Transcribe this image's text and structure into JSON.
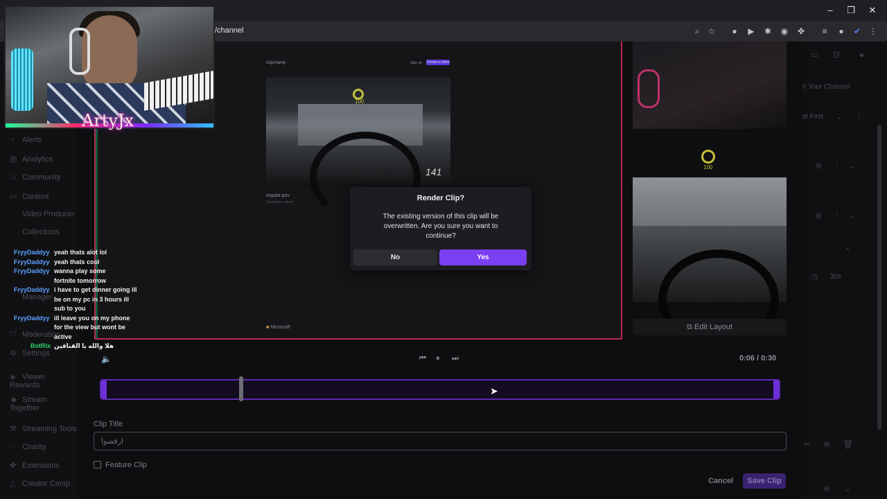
{
  "browser": {
    "url": "/channel",
    "window_controls": [
      "–",
      "❐",
      "✕"
    ]
  },
  "sidebar": {
    "items": [
      {
        "label": "Alerts",
        "icon": "bell-icon"
      },
      {
        "label": "Analytics",
        "icon": "chart-icon"
      },
      {
        "label": "Community",
        "icon": "people-icon"
      },
      {
        "label": "Content",
        "icon": "folder-icon"
      },
      {
        "label": "Video Producer",
        "icon": ""
      },
      {
        "label": "Collections",
        "icon": ""
      },
      {
        "label": "Manager",
        "icon": ""
      },
      {
        "label": "Moderation",
        "icon": "shield-icon"
      },
      {
        "label": "Settings",
        "icon": "gear-icon"
      },
      {
        "label": "Viewer Rewards",
        "icon": "gift-icon"
      },
      {
        "label": "Stream Together",
        "icon": "users-icon"
      },
      {
        "label": "Streaming Tools",
        "icon": "tools-icon"
      },
      {
        "label": "Charity",
        "icon": "heart-icon"
      },
      {
        "label": "Extensions",
        "icon": "puzzle-icon"
      },
      {
        "label": "Creator Camp",
        "icon": "tent-icon"
      }
    ]
  },
  "right_ghost": {
    "channel_label": "n Your Channel",
    "sort_label": "st First",
    "duration": "30s"
  },
  "webcam": {
    "streamer_name": "ArtyJx"
  },
  "preview": {
    "app_name": "Clipchamp",
    "signup": "Sign up",
    "create": "Create a video",
    "video_title": "impala pov",
    "video_sub": "Created by admin",
    "footer_brand": "Microsoft",
    "speed_text": "141",
    "gauge_value": "100"
  },
  "right_cam": {
    "gauge_value": "100",
    "edit_layout_label": "Edit Layout"
  },
  "chat": [
    {
      "user": "FryyDaddyy",
      "message": "yeah thats alot lol",
      "bot": false
    },
    {
      "user": "FryyDaddyy",
      "message": "yeah thats cool",
      "bot": false
    },
    {
      "user": "FryyDaddyy",
      "message": "wanna play some fortnite tomorrow",
      "bot": false
    },
    {
      "user": "FryyDaddyy",
      "message": "i have to get dinner going ill be on my pc in 3 hours ill sub to you",
      "bot": false
    },
    {
      "user": "FryyDaddyy",
      "message": "ill leave you on my phone for the view but wont be active",
      "bot": false
    },
    {
      "user": "BotRix",
      "message": "هلا والله يا القناقين",
      "bot": true
    }
  ],
  "player": {
    "timecode": "0:06 / 0:30",
    "progress_fraction": 0.2
  },
  "form": {
    "clip_title_label": "Clip Title",
    "clip_title_value": "ارقصوا",
    "feature_label": "Feature Clip",
    "cancel_label": "Cancel",
    "save_label": "Save Clip"
  },
  "dialog": {
    "title": "Render Clip?",
    "body": "The existing version of this clip will be overwritten. Are you sure you want to continue?",
    "no_label": "No",
    "yes_label": "Yes"
  },
  "colors": {
    "accent": "#7b3ff2",
    "chat_user": "#5aa0ff",
    "bot_user": "#31d16b"
  }
}
